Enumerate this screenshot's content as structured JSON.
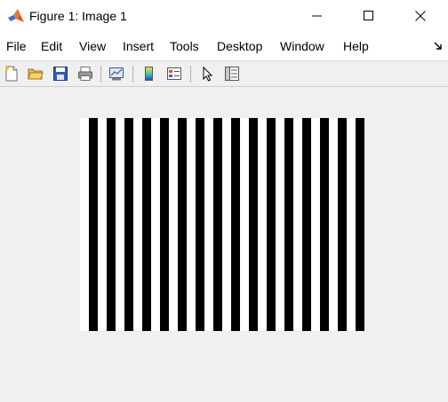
{
  "window": {
    "title": "Figure 1: Image 1"
  },
  "menu": {
    "items": [
      "File",
      "Edit",
      "View",
      "Insert",
      "Tools",
      "Desktop",
      "Window",
      "Help"
    ]
  },
  "toolbar": {
    "buttons": [
      {
        "name": "new-figure-icon"
      },
      {
        "name": "open-file-icon"
      },
      {
        "name": "save-icon"
      },
      {
        "name": "print-icon"
      },
      {
        "name": "link-plot-icon"
      },
      {
        "name": "insert-colorbar-icon"
      },
      {
        "name": "insert-legend-icon"
      },
      {
        "name": "edit-plot-icon"
      },
      {
        "name": "property-inspector-icon"
      }
    ]
  },
  "image": {
    "background": "#ffffff",
    "stripe_color": "#000000",
    "stripe_count": 16
  }
}
